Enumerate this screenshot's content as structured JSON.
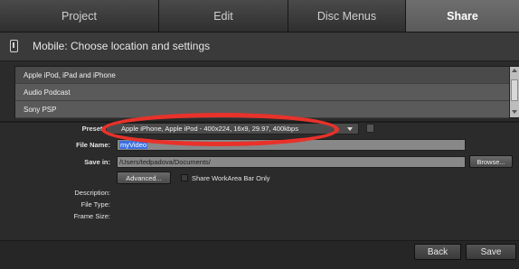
{
  "tabs": [
    {
      "label": "Project"
    },
    {
      "label": "Edit"
    },
    {
      "label": "Disc Menus"
    },
    {
      "label": "Share"
    }
  ],
  "header": {
    "title": "Mobile: Choose location and settings",
    "icon": "mobile-phone-icon"
  },
  "device_list": {
    "items": [
      {
        "label": "Apple iPod, iPad and iPhone"
      },
      {
        "label": "Audio Podcast"
      },
      {
        "label": "Sony PSP"
      }
    ]
  },
  "form": {
    "preset_label": "Preset:",
    "preset_value": "Apple iPhone, Apple iPod - 400x224, 16x9, 29.97, 400kbps",
    "file_name_label": "File Name:",
    "file_name_value": "myVideo",
    "save_in_label": "Save in:",
    "save_in_value": "/Users/tedpadova/Documents/",
    "browse_label": "Browse...",
    "advanced_label": "Advanced...",
    "share_workarea_label": "Share WorkArea Bar Only",
    "description_label": "Description:",
    "file_type_label": "File Type:",
    "frame_size_label": "Frame Size:"
  },
  "footer": {
    "back_label": "Back",
    "save_label": "Save"
  },
  "colors": {
    "callout": "#e8322a",
    "selection": "#3b6fe0"
  }
}
